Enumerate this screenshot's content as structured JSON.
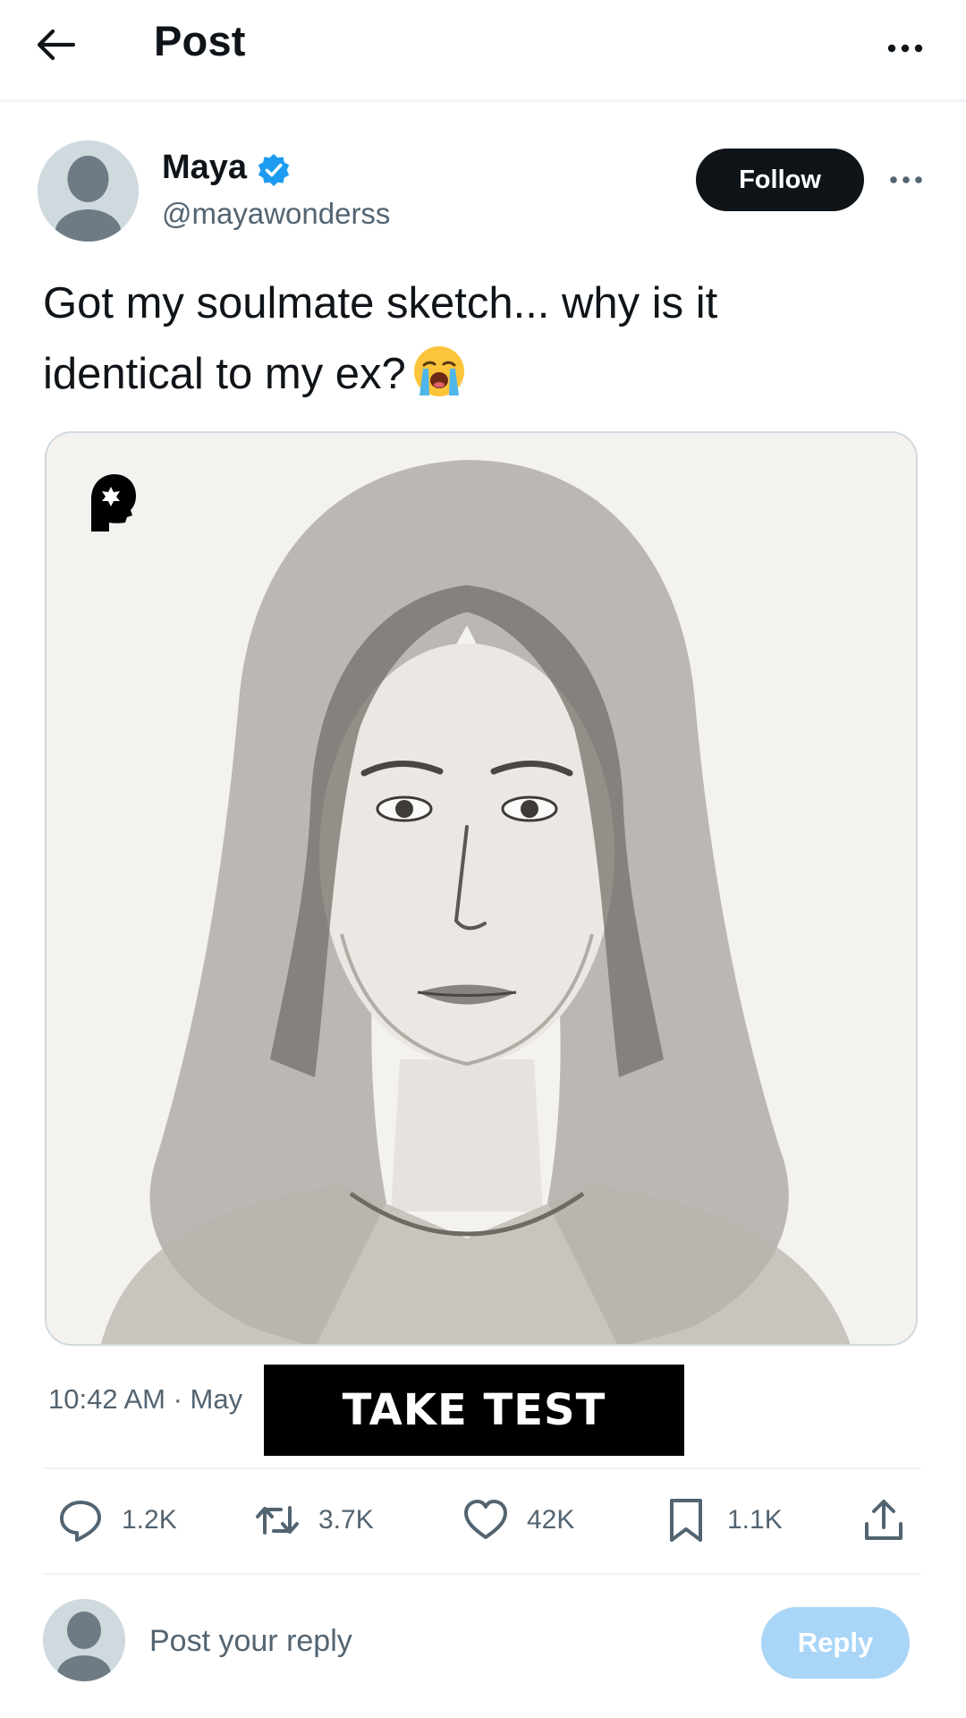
{
  "header": {
    "title": "Post",
    "back_icon": "arrow-left-icon",
    "more_icon": "more-horizontal-icon"
  },
  "post": {
    "author": {
      "name": "Maya",
      "handle": "@mayawonderss",
      "verified": true,
      "avatar_icon": "default-avatar-icon",
      "follow_label": "Follow"
    },
    "text_line1": "Got my soulmate sketch... why is it",
    "text_line2": "identical to my ex?",
    "emoji_icon": "loudly-crying-face-emoji",
    "media": {
      "kind": "pencil sketch portrait",
      "brand_icon": "head-silhouette-logo-icon"
    },
    "timestamp": "10:42 AM · May",
    "cta_label": "TAKE TEST"
  },
  "actions": {
    "replies": "1.2K",
    "reposts": "3.7K",
    "likes": "42K",
    "bookmarks": "1.1K",
    "share_icon": "share-icon"
  },
  "reply_bar": {
    "placeholder": "Post your reply",
    "button_label": "Reply"
  },
  "colors": {
    "text_primary": "#0f1419",
    "text_secondary": "#536471",
    "verified_blue": "#1d9bf0",
    "reply_button_disabled": "#a9d5f7",
    "cta_background": "#000000"
  }
}
